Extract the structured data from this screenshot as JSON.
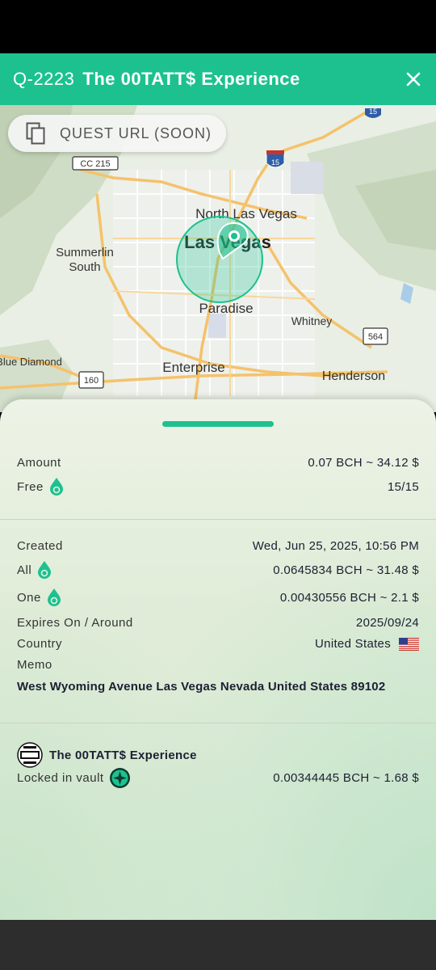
{
  "header": {
    "quest_id": "Q-2223",
    "title": "The 00TATT$ Experience"
  },
  "map": {
    "quest_url_label": "QUEST URL (SOON)",
    "labels": {
      "north_las_vegas": "North Las Vegas",
      "las_vegas": "Las Vegas",
      "summerlin": "Summerlin",
      "south": "South",
      "paradise": "Paradise",
      "whitney": "Whitney",
      "blue_diamond": "Blue Diamond",
      "enterprise": "Enterprise",
      "henderson": "Henderson"
    },
    "shields": {
      "cc215": "CC 215",
      "i15_top": "15",
      "i15_mid": "15",
      "r564": "564",
      "r160": "160"
    }
  },
  "details": {
    "amount_label": "Amount",
    "amount_value": "0.07 BCH ~ 34.12 $",
    "free_label": "Free",
    "free_value": "15/15",
    "created_label": "Created",
    "created_value": "Wed, Jun 25, 2025, 10:56 PM",
    "all_label": "All",
    "all_value": "0.0645834 BCH ~ 31.48 $",
    "one_label": "One",
    "one_value": "0.00430556 BCH ~ 2.1 $",
    "expires_label": "Expires On / Around",
    "expires_value": "2025/09/24",
    "country_label": "Country",
    "country_value": "United States",
    "memo_label": "Memo",
    "memo_value": "West Wyoming Avenue Las Vegas Nevada United States 89102"
  },
  "vault": {
    "brand_name": "The 00TATT$ Experience",
    "locked_label": "Locked in vault",
    "locked_value": "0.00344445 BCH ~ 1.68 $"
  },
  "colors": {
    "accent": "#1cc18f",
    "text": "#1d1f33"
  }
}
